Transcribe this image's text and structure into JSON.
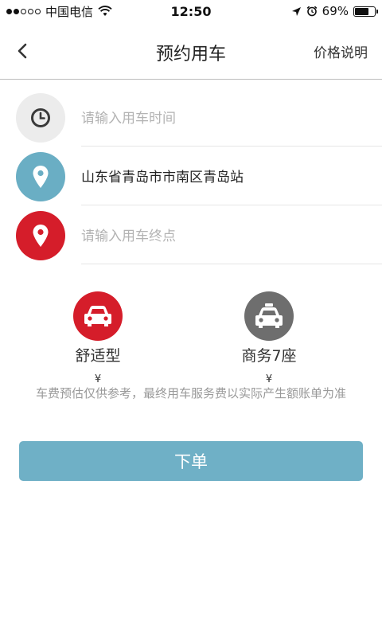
{
  "status_bar": {
    "carrier": "中国电信",
    "time": "12:50",
    "battery": "69%",
    "battery_level": 0.69,
    "signal_dots_filled": 2,
    "signal_dots_total": 5
  },
  "nav": {
    "title": "预约用车",
    "right_label": "价格说明",
    "back_icon": "chevron-left-icon"
  },
  "form": {
    "time": {
      "placeholder": "请输入用车时间",
      "icon": "clock-icon",
      "color": "#ececec"
    },
    "start": {
      "value": "山东省青岛市市南区青岛站",
      "icon": "location-pin-icon",
      "color": "#6aaec4"
    },
    "end": {
      "placeholder": "请输入用车终点",
      "icon": "location-pin-icon",
      "color": "#d51d2a"
    }
  },
  "car_types": [
    {
      "name": "舒适型",
      "price": "¥",
      "icon": "car-icon",
      "color": "#d51d2a"
    },
    {
      "name": "商务7座",
      "price": "¥",
      "icon": "taxi-icon",
      "color": "#6e6e6e"
    }
  ],
  "note": "车费预估仅供参考，最终用车服务费以实际产生额账单为准",
  "order_button": {
    "label": "下单",
    "color": "#6fb0c6"
  }
}
